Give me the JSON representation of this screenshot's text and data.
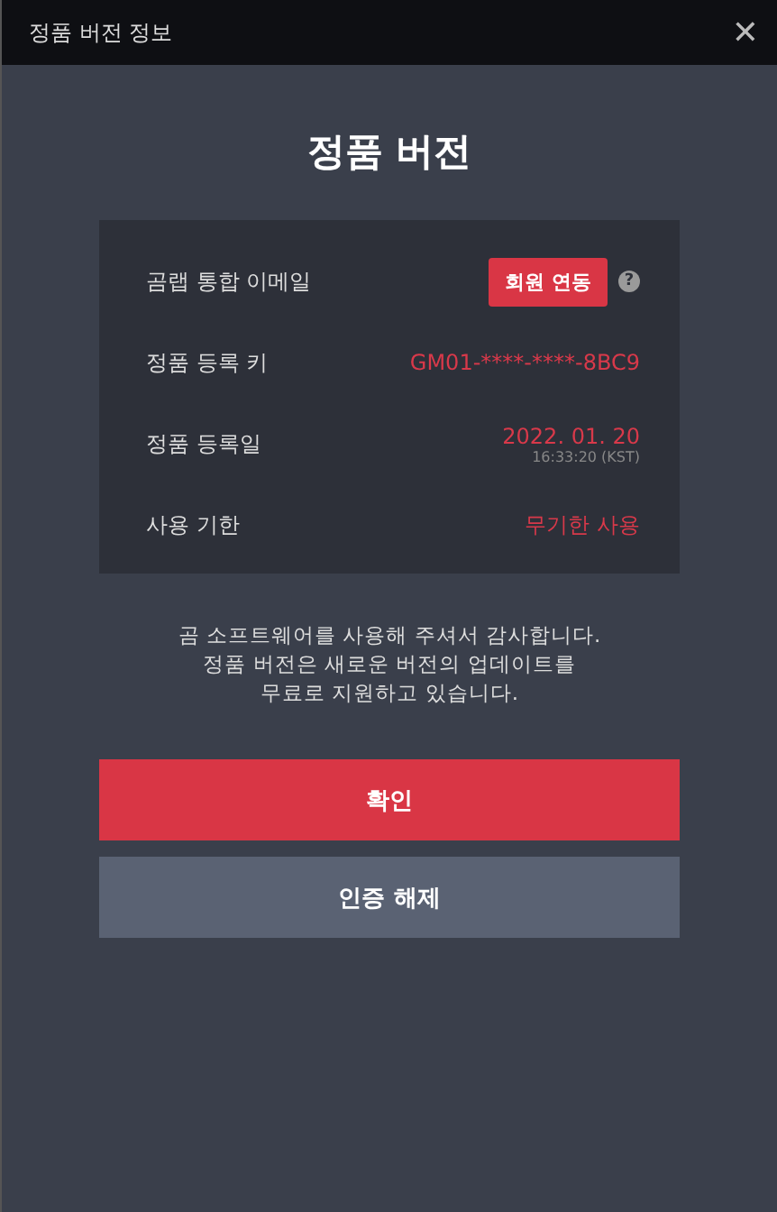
{
  "window": {
    "title": "정품 버전 정보",
    "close": "✕"
  },
  "heading": "정품 버전",
  "info_rows": [
    {
      "kind": "button",
      "label": "곰랩 통합 이메일",
      "button": "회원 연동",
      "help": "?"
    },
    {
      "kind": "value",
      "label": "정품 등록 키",
      "value": "GM01-****-****-8BC9"
    },
    {
      "kind": "date",
      "label": "정품 등록일",
      "value": "2022. 01. 20",
      "time": "16:33:20 (KST)"
    },
    {
      "kind": "value",
      "label": "사용 기한",
      "value": "무기한 사용"
    }
  ],
  "message": [
    "곰 소프트웨어를 사용해 주셔서 감사합니다.",
    "정품 버전은 새로운 버전의 업데이트를",
    "무료로 지원하고 있습니다."
  ],
  "buttons": [
    {
      "kind": "primary",
      "label": "확인"
    },
    {
      "kind": "secondary",
      "label": "인증 해제"
    }
  ]
}
